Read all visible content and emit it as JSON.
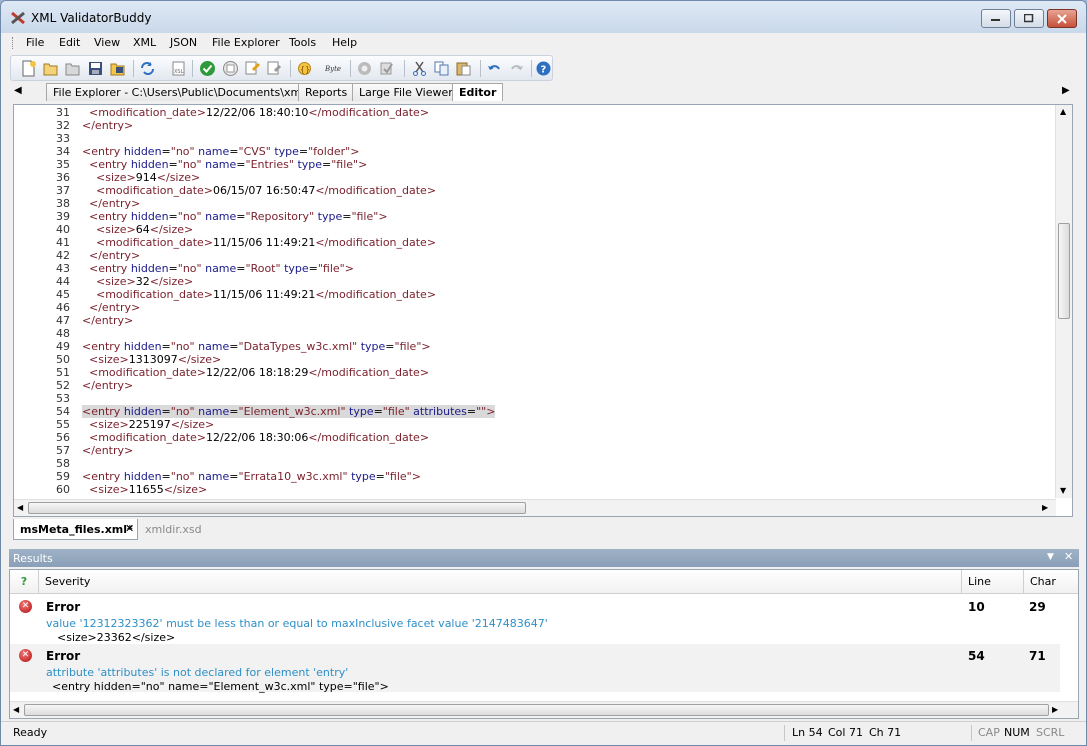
{
  "window": {
    "title": "XML ValidatorBuddy"
  },
  "menu": [
    "File",
    "Edit",
    "View",
    "XML",
    "JSON",
    "File Explorer",
    "Tools",
    "Help"
  ],
  "toolbar_icons": [
    "new-file-icon",
    "open-icon",
    "open-folder-icon",
    "save-icon",
    "save-all-icon",
    "refresh-icon",
    "xsl-icon",
    "validate-check-icon",
    "check-wellformed-icon",
    "transform-icon",
    "batch-icon",
    "format-xml-icon",
    "byte-icon",
    "find-icon",
    "properties-icon",
    "cut-icon",
    "copy-icon",
    "paste-icon",
    "undo-icon",
    "redo-icon",
    "help-icon"
  ],
  "doc_tabs": [
    {
      "label": "File Explorer - C:\\Users\\Public\\Documents\\xml"
    },
    {
      "label": "Reports"
    },
    {
      "label": "Large File Viewer"
    },
    {
      "label": "Editor"
    }
  ],
  "code_lines": [
    {
      "n": "31",
      "text": "  <modification_date>12/22/06 18:40:10</modification_date>"
    },
    {
      "n": "32",
      "text": "</entry>"
    },
    {
      "n": "33",
      "text": ""
    },
    {
      "n": "34",
      "text": "<entry hidden=\"no\" name=\"CVS\" type=\"folder\">"
    },
    {
      "n": "35",
      "text": "  <entry hidden=\"no\" name=\"Entries\" type=\"file\">"
    },
    {
      "n": "36",
      "text": "    <size>914</size>"
    },
    {
      "n": "37",
      "text": "    <modification_date>06/15/07 16:50:47</modification_date>"
    },
    {
      "n": "38",
      "text": "  </entry>"
    },
    {
      "n": "39",
      "text": "  <entry hidden=\"no\" name=\"Repository\" type=\"file\">"
    },
    {
      "n": "40",
      "text": "    <size>64</size>"
    },
    {
      "n": "41",
      "text": "    <modification_date>11/15/06 11:49:21</modification_date>"
    },
    {
      "n": "42",
      "text": "  </entry>"
    },
    {
      "n": "43",
      "text": "  <entry hidden=\"no\" name=\"Root\" type=\"file\">"
    },
    {
      "n": "44",
      "text": "    <size>32</size>"
    },
    {
      "n": "45",
      "text": "    <modification_date>11/15/06 11:49:21</modification_date>"
    },
    {
      "n": "46",
      "text": "  </entry>"
    },
    {
      "n": "47",
      "text": "</entry>"
    },
    {
      "n": "48",
      "text": ""
    },
    {
      "n": "49",
      "text": "<entry hidden=\"no\" name=\"DataTypes_w3c.xml\" type=\"file\">"
    },
    {
      "n": "50",
      "text": "  <size>1313097</size>"
    },
    {
      "n": "51",
      "text": "  <modification_date>12/22/06 18:18:29</modification_date>"
    },
    {
      "n": "52",
      "text": "</entry>"
    },
    {
      "n": "53",
      "text": ""
    },
    {
      "n": "54",
      "text": "<entry hidden=\"no\" name=\"Element_w3c.xml\" type=\"file\" attributes=\"\">",
      "highlight": true
    },
    {
      "n": "55",
      "text": "  <size>225197</size>"
    },
    {
      "n": "56",
      "text": "  <modification_date>12/22/06 18:30:06</modification_date>"
    },
    {
      "n": "57",
      "text": "</entry>"
    },
    {
      "n": "58",
      "text": ""
    },
    {
      "n": "59",
      "text": "<entry hidden=\"no\" name=\"Errata10_w3c.xml\" type=\"file\">"
    },
    {
      "n": "60",
      "text": "  <size>11655</size>"
    }
  ],
  "file_tabs": [
    {
      "label": "msMeta_files.xml*"
    },
    {
      "label": "xmldir.xsd"
    }
  ],
  "results": {
    "title": "Results",
    "headers": {
      "icon": "?",
      "severity": "Severity",
      "line": "Line",
      "char": "Char"
    },
    "rows": [
      {
        "severity": "Error",
        "message": "value '12312323362' must be less than or equal to maxInclusive facet value '2147483647'",
        "context": "<size>23362</size>",
        "line": "10",
        "char": "29"
      },
      {
        "severity": "Error",
        "message": "attribute 'attributes' is not declared for element 'entry'",
        "context": "<entry hidden=\"no\" name=\"Element_w3c.xml\" type=\"file\">",
        "line": "54",
        "char": "71"
      }
    ]
  },
  "status": {
    "ready": "Ready",
    "ln": "Ln 54",
    "col": "Col 71",
    "ch": "Ch 71",
    "cap": "CAP",
    "num": "NUM",
    "scrl": "SCRL"
  },
  "colors": {
    "tag": "#7a1f2b",
    "attr": "#1a1a8c",
    "message": "#2d8fc7",
    "error": "#b00d0d"
  }
}
